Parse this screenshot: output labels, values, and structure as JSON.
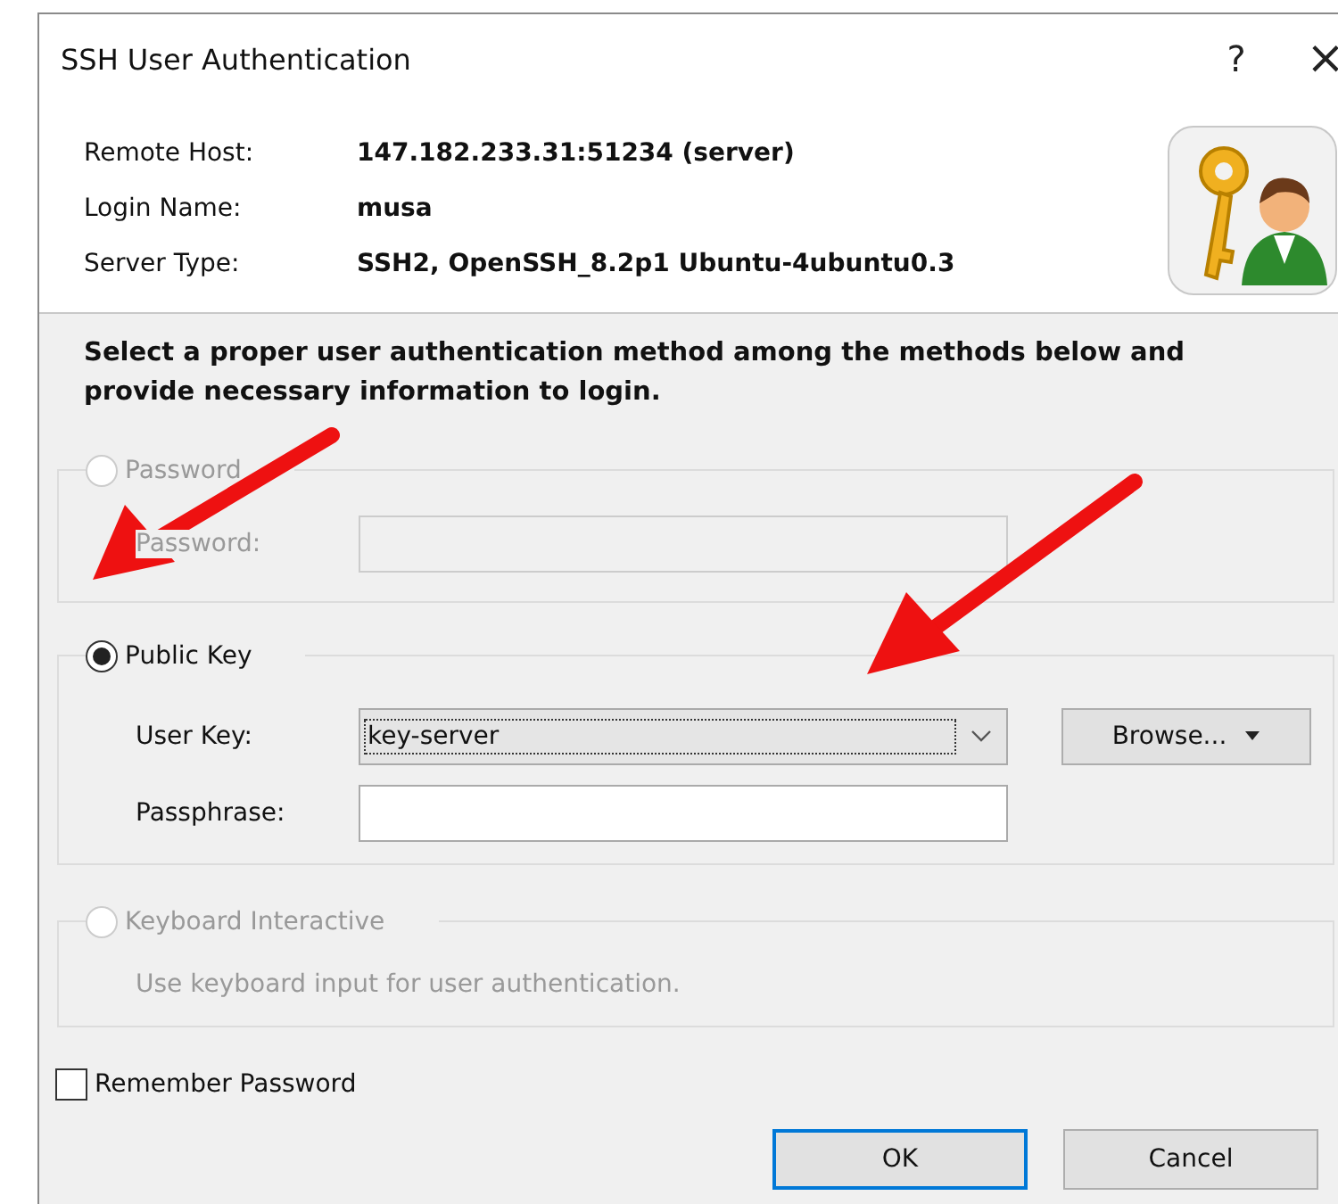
{
  "window": {
    "title": "SSH User Authentication",
    "help": "?",
    "close": "×"
  },
  "info": [
    {
      "label": "Remote Host:",
      "value": "147.182.233.31:51234 (server)"
    },
    {
      "label": "Login Name:",
      "value": "musa"
    },
    {
      "label": "Server Type:",
      "value": "SSH2, OpenSSH_8.2p1 Ubuntu-4ubuntu0.3"
    }
  ],
  "instruction": "Select a proper user authentication method among the methods below and provide necessary information to login.",
  "methods": [
    {
      "kind": "password",
      "label": "Password",
      "selected": false,
      "disabled": true,
      "field_label": "Password:"
    },
    {
      "kind": "publickey",
      "label": "Public Key",
      "selected": true,
      "disabled": false,
      "key_label": "User Key:",
      "key_value": "key-server",
      "browse": "Browse...",
      "passphrase_label": "Passphrase:"
    },
    {
      "kind": "keyboard",
      "label": "Keyboard Interactive",
      "selected": false,
      "disabled": true,
      "description": "Use keyboard input for user authentication."
    }
  ],
  "remember": {
    "label": "Remember Password",
    "checked": false
  },
  "buttons": [
    "OK",
    "Cancel"
  ]
}
